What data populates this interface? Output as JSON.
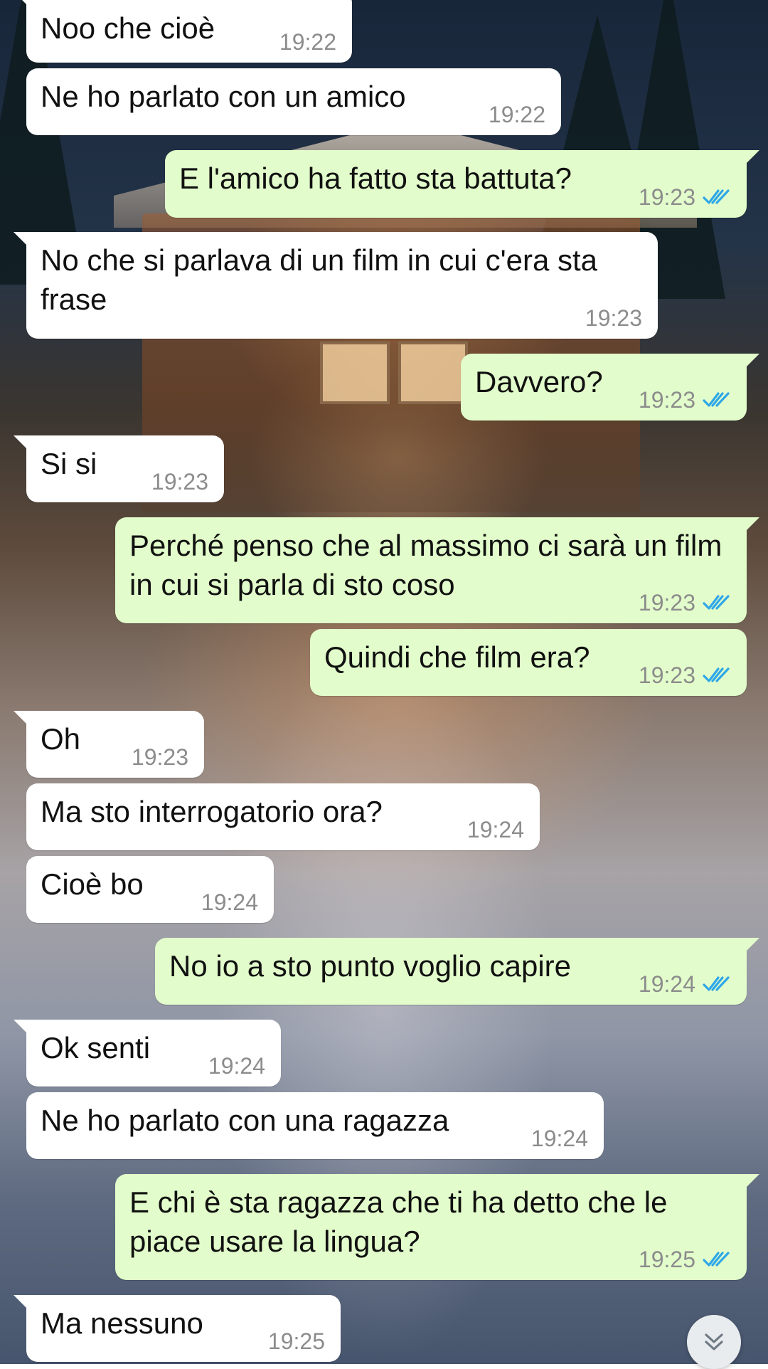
{
  "colors": {
    "incoming_bubble": "#ffffff",
    "outgoing_bubble": "#e2fdcb",
    "read_ticks": "#2fa7e8",
    "timestamp": "#8c8c8c"
  },
  "messages": [
    {
      "text": "Noo che cioè",
      "time": "19:22",
      "direction": "in"
    },
    {
      "text": "Ne ho parlato con un amico",
      "time": "19:22",
      "direction": "in"
    },
    {
      "text": "E l'amico ha fatto sta battuta?",
      "time": "19:23",
      "direction": "out",
      "status_icon": "double-check-icon"
    },
    {
      "text": "No che si parlava di un film in cui c'era sta frase",
      "time": "19:23",
      "direction": "in"
    },
    {
      "text": "Davvero?",
      "time": "19:23",
      "direction": "out",
      "status_icon": "double-check-icon"
    },
    {
      "text": "Si si",
      "time": "19:23",
      "direction": "in"
    },
    {
      "text": "Perché penso che al massimo ci sarà un film in cui si parla di sto coso",
      "time": "19:23",
      "direction": "out",
      "status_icon": "double-check-icon"
    },
    {
      "text": "Quindi che film era?",
      "time": "19:23",
      "direction": "out",
      "status_icon": "double-check-icon"
    },
    {
      "text": "Oh",
      "time": "19:23",
      "direction": "in"
    },
    {
      "text": "Ma sto interrogatorio ora?",
      "time": "19:24",
      "direction": "in"
    },
    {
      "text": "Cioè bo",
      "time": "19:24",
      "direction": "in"
    },
    {
      "text": "No io a sto punto voglio capire",
      "time": "19:24",
      "direction": "out",
      "status_icon": "double-check-icon"
    },
    {
      "text": "Ok senti",
      "time": "19:24",
      "direction": "in"
    },
    {
      "text": "Ne ho parlato con una ragazza",
      "time": "19:24",
      "direction": "in"
    },
    {
      "text": "E chi è sta ragazza che ti ha detto che le piace usare la lingua?",
      "time": "19:25",
      "direction": "out",
      "status_icon": "double-check-icon"
    },
    {
      "text": "Ma nessuno",
      "time": "19:25",
      "direction": "in"
    }
  ],
  "scroll_button": {
    "icon": "double-chevron-down-icon"
  }
}
